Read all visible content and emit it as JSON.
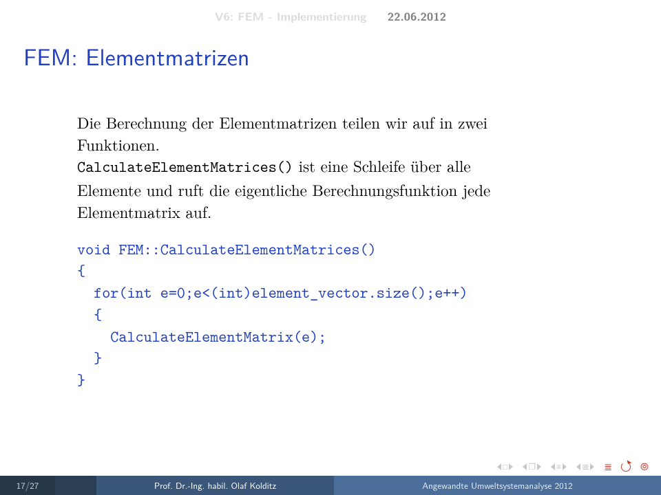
{
  "header": {
    "left": "V6: FEM - Implementierung",
    "right": "22.06.2012"
  },
  "title": "FEM: Elementmatrizen",
  "para1_a": "Die Berechnung der Elementmatrizen teilen wir auf in zwei",
  "para1_b": "Funktionen.",
  "para2_tt": "CalculateElementMatrices()",
  "para2_a": " ist eine Schleife über alle",
  "para2_b": "Elemente und ruft die eigentliche Berechnungsfunktion jede",
  "para2_c": "Elementmatrix auf.",
  "code": "void FEM::CalculateElementMatrices()\n{\n  for(int e=0;e<(int)element_vector.size();e++)\n  {\n    CalculateElementMatrix(e);\n  }\n}",
  "footer": {
    "page": "17/27",
    "author": "Prof. Dr.-Ing. habil. Olaf Kolditz",
    "title": "Angewandte Umweltsystemanalyse 2012"
  }
}
